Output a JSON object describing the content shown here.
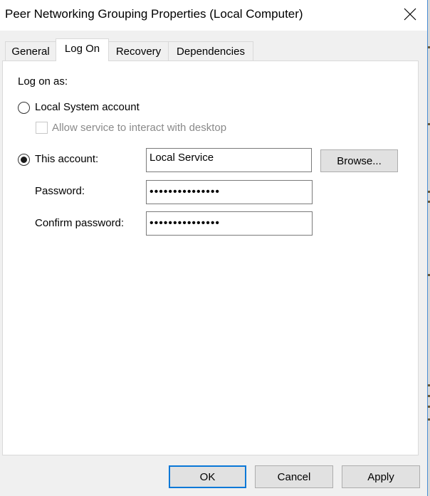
{
  "window": {
    "title": "Peer Networking Grouping Properties (Local Computer)",
    "close_icon": "close-x-icon"
  },
  "tabs": [
    {
      "label": "General",
      "active": false
    },
    {
      "label": "Log On",
      "active": true
    },
    {
      "label": "Recovery",
      "active": false
    },
    {
      "label": "Dependencies",
      "active": false
    }
  ],
  "logon": {
    "heading": "Log on as:",
    "local_system": {
      "label": "Local System account",
      "selected": false
    },
    "interact_desktop": {
      "label": "Allow service to interact with desktop",
      "checked": false,
      "enabled": false
    },
    "this_account": {
      "label": "This account:",
      "selected": true,
      "value": "Local Service"
    },
    "browse_label": "Browse...",
    "password": {
      "label": "Password:",
      "value": "•••••••••••••••"
    },
    "confirm_password": {
      "label": "Confirm password:",
      "value": "•••••••••••••••"
    }
  },
  "footer": {
    "ok_label": "OK",
    "cancel_label": "Cancel",
    "apply_label": "Apply"
  },
  "colors": {
    "accent": "#0a78d7",
    "window_border": "#4a8fd6"
  }
}
